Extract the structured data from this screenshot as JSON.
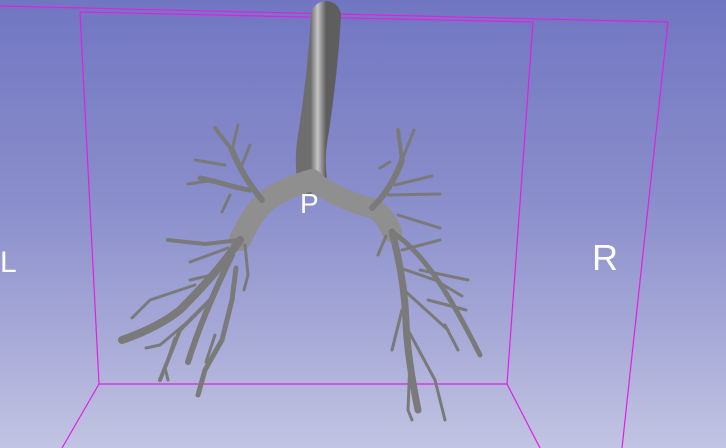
{
  "viewer": {
    "background_top": "#7176c2",
    "background_bottom": "#c2c4e3",
    "bounding_box_color": "#e020e0",
    "model_color": "#8a8a8a",
    "model_name": "airway-tree"
  },
  "orientation_labels": {
    "left": "L",
    "right": "R",
    "posterior": "P"
  }
}
